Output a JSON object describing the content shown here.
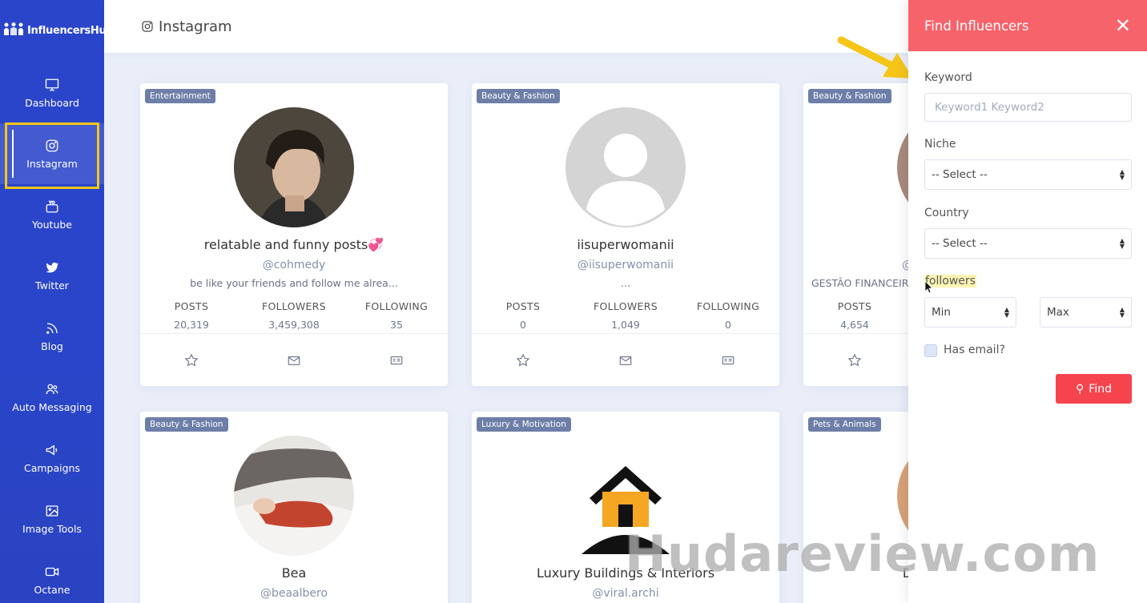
{
  "app": {
    "name": "InfluencersHub"
  },
  "sidebar": {
    "items": [
      {
        "label": "Dashboard",
        "icon": "monitor-icon"
      },
      {
        "label": "Instagram",
        "icon": "instagram-icon",
        "active": true
      },
      {
        "label": "Youtube",
        "icon": "youtube-icon"
      },
      {
        "label": "Twitter",
        "icon": "twitter-icon"
      },
      {
        "label": "Blog",
        "icon": "rss-icon"
      },
      {
        "label": "Auto Messaging",
        "icon": "users-icon"
      },
      {
        "label": "Campaigns",
        "icon": "megaphone-icon"
      },
      {
        "label": "Image Tools",
        "icon": "image-icon"
      },
      {
        "label": "Octane",
        "icon": "video-icon"
      }
    ]
  },
  "header": {
    "title": "Instagram"
  },
  "stat_labels": {
    "posts": "POSTS",
    "followers": "FOLLOWERS",
    "following": "FOLLOWING"
  },
  "cards": [
    {
      "category": "Entertainment",
      "name": "relatable and funny posts💞",
      "handle": "@cohmedy",
      "bio": "be like your friends and follow me alrea...",
      "posts": "20,319",
      "followers": "3,459,308",
      "following": "35"
    },
    {
      "category": "Beauty & Fashion",
      "name": "iisuperwomanii",
      "handle": "@iisuperwomanii",
      "bio": "...",
      "posts": "0",
      "followers": "1,049",
      "following": "0"
    },
    {
      "category": "Beauty & Fashion",
      "name": "",
      "handle": "@",
      "bio": "GESTÃO FINANCEIRA",
      "posts": "4,654",
      "followers": "",
      "following": ""
    },
    {
      "category": "Beauty & Fashion",
      "name": "Bea",
      "handle": "@beaalbero"
    },
    {
      "category": "Luxury & Motivation",
      "name": "Luxury Buildings & Interiors",
      "handle": "@viral.archi"
    },
    {
      "category": "Pets & Animals",
      "name": "D",
      "handle": ""
    }
  ],
  "panel": {
    "title": "Find Influencers",
    "keyword_label": "Keyword",
    "keyword_placeholder": "Keyword1 Keyword2",
    "niche_label": "Niche",
    "niche_value": "-- Select --",
    "country_label": "Country",
    "country_value": "-- Select --",
    "followers_label": "followers",
    "min_value": "Min",
    "max_value": "Max",
    "has_email_label": "Has email?",
    "find_label": "Find"
  },
  "watermark": "Hudareview.com",
  "colors": {
    "sidebar": "#2a45c9",
    "panel_header": "#f7636a",
    "find_button": "#f6444f",
    "badge": "#6d7fa8",
    "annotation": "#f5c518"
  }
}
